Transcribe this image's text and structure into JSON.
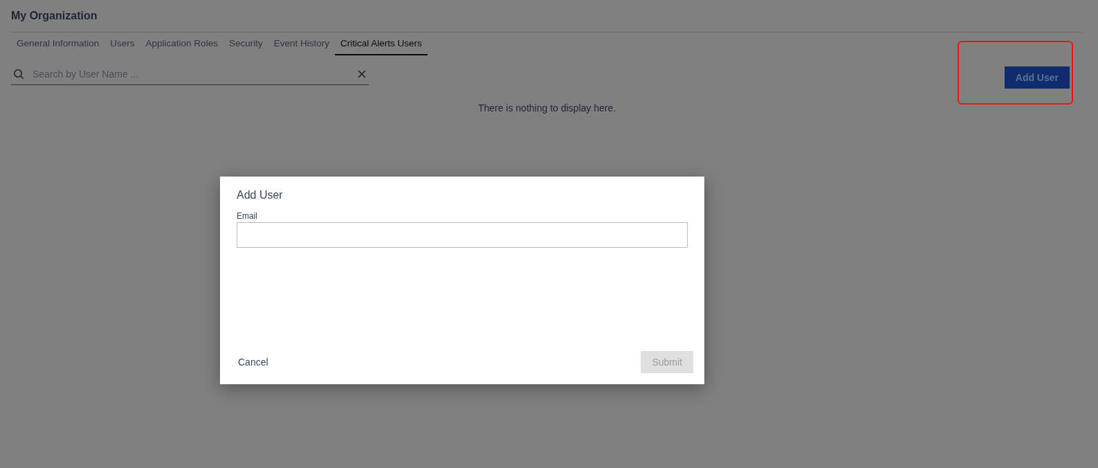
{
  "page_title": "My Organization",
  "tabs": [
    {
      "label": "General Information",
      "selected": false
    },
    {
      "label": "Users",
      "selected": false
    },
    {
      "label": "Application Roles",
      "selected": false
    },
    {
      "label": "Security",
      "selected": false
    },
    {
      "label": "Event History",
      "selected": false
    },
    {
      "label": "Critical Alerts Users",
      "selected": true
    }
  ],
  "search": {
    "placeholder": "Search by User Name ..."
  },
  "add_button": {
    "label": "Add User",
    "highlighted": true
  },
  "empty_message": "There is nothing to display here.",
  "dialog": {
    "title": "Add User",
    "field_label": "Email",
    "cancel": "Cancel",
    "submit": {
      "label": "Submit",
      "disabled": true
    }
  }
}
